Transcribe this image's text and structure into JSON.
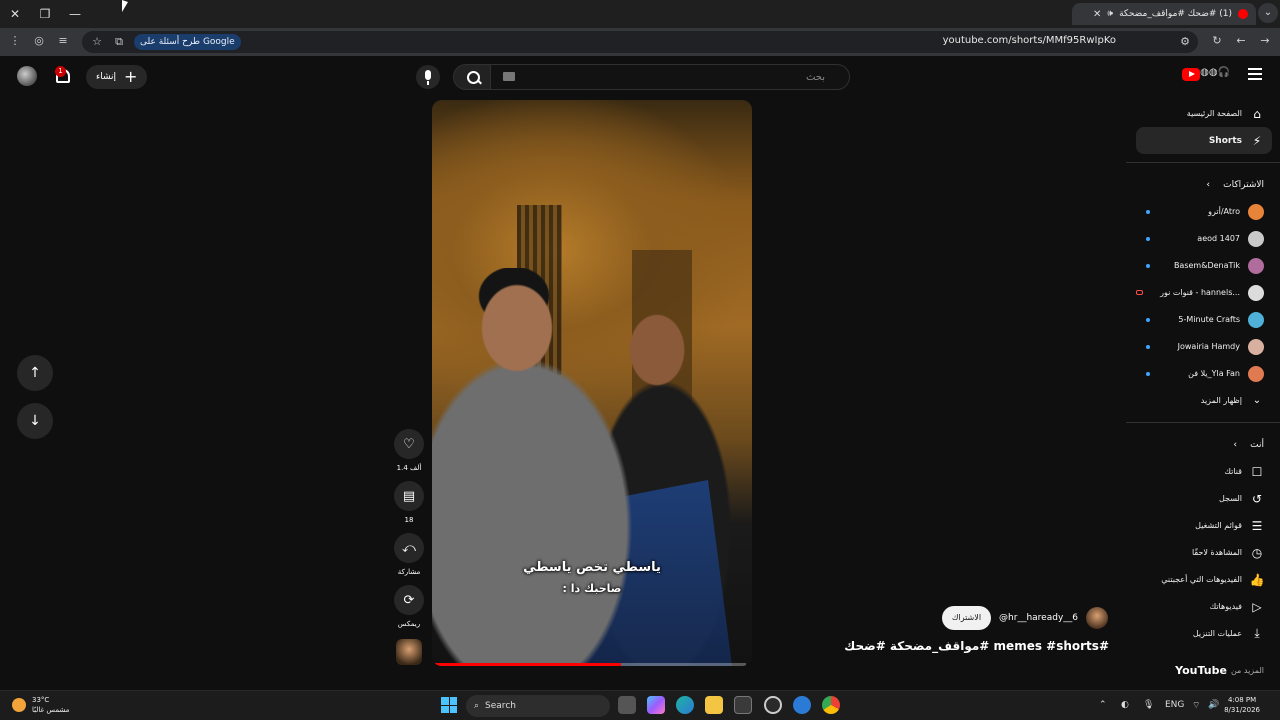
{
  "browser": {
    "tab_title": "(1) #ضحك #مواقف_مضحكة",
    "url": "youtube.com/shorts/MMf95RwIpKo",
    "ask_google": "طرح أسئلة على Google"
  },
  "header": {
    "search_placeholder": "بحث",
    "create_label": "إنشاء",
    "notifications_count": "1"
  },
  "sidebar": {
    "home": "الصفحة الرئيسية",
    "shorts": "Shorts",
    "subscriptions_heading": "الاشتراكات",
    "subscriptions": [
      {
        "name": "أترو/Atro",
        "avatar_color": "#e8833a"
      },
      {
        "name": "aeod 1407",
        "avatar_color": "#c9c9c9"
      },
      {
        "name": "Basem&DenaTik",
        "avatar_color": "#b06c9c"
      },
      {
        "name": "قنوات نور - hannels...",
        "avatar_color": "#dcdcdc"
      },
      {
        "name": "5-Minute Crafts",
        "avatar_color": "#4fb0d8"
      },
      {
        "name": "Jowairia Hamdy",
        "avatar_color": "#d8b0a0"
      },
      {
        "name": "يلا فن_Yla Fan",
        "avatar_color": "#e07a50"
      }
    ],
    "show_more": "إظهار المزيد",
    "you_heading": "أنت",
    "you_items": [
      {
        "label": "قناتك",
        "icon": "person-icon"
      },
      {
        "label": "السجل",
        "icon": "history-icon"
      },
      {
        "label": "قوائم التشغيل",
        "icon": "playlist-icon"
      },
      {
        "label": "المشاهدة لاحقًا",
        "icon": "clock-icon"
      },
      {
        "label": "الفيديوهات التي أعجبتني",
        "icon": "thumbs-up-icon"
      },
      {
        "label": "فيديوهاتك",
        "icon": "video-icon"
      },
      {
        "label": "عمليات التنزيل",
        "icon": "download-icon"
      }
    ],
    "more_from": "المزيد من",
    "more_from_brand": "YouTube"
  },
  "video": {
    "caption_line1": "ياسطي تخص ياسطي",
    "caption_line2": "صاحبك دا :",
    "progress": 0.6,
    "channel_handle": "@hr__haready__6",
    "subscribe_label": "الاشتراك",
    "title": "#memes #shorts #مواقف_مضحكة #ضحك"
  },
  "actions": {
    "likes": "1.4 ألف",
    "comments": "18",
    "share": "مشاركة",
    "remix": "ريمكس"
  },
  "taskbar": {
    "temperature": "33°C",
    "weather": "مشمس غالبًا",
    "search": "Search",
    "language": "ENG",
    "time": "4:08 PM",
    "date": "8/31/2026"
  }
}
